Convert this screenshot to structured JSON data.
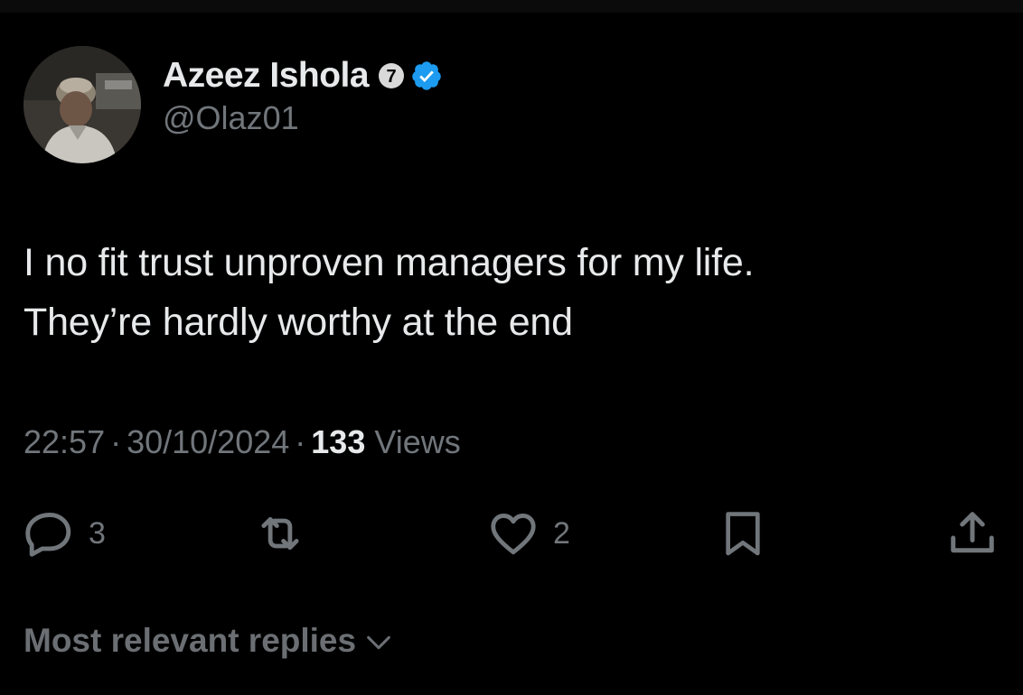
{
  "author": {
    "display_name": "Azeez Ishola",
    "handle": "@Olaz01",
    "badge_number": "7",
    "verified": true,
    "verified_color": "#1d9bf0"
  },
  "tweet": {
    "lines": [
      "I no fit trust unproven managers for my life.",
      "They’re hardly worthy at the end"
    ],
    "time": "22:57",
    "date": "30/10/2024",
    "separator": "·",
    "views_count": "133",
    "views_label": "Views"
  },
  "actions": {
    "reply": {
      "icon": "reply-icon",
      "count": "3"
    },
    "repost": {
      "icon": "repost-icon",
      "count": ""
    },
    "like": {
      "icon": "heart-icon",
      "count": "2"
    },
    "bookmark": {
      "icon": "bookmark-icon",
      "count": ""
    },
    "share": {
      "icon": "share-icon",
      "count": ""
    }
  },
  "replies": {
    "sort_label": "Most relevant replies"
  },
  "colors": {
    "background": "#000000",
    "primary_text": "#e7e9ea",
    "secondary_text": "#71767b",
    "accent": "#1d9bf0"
  }
}
